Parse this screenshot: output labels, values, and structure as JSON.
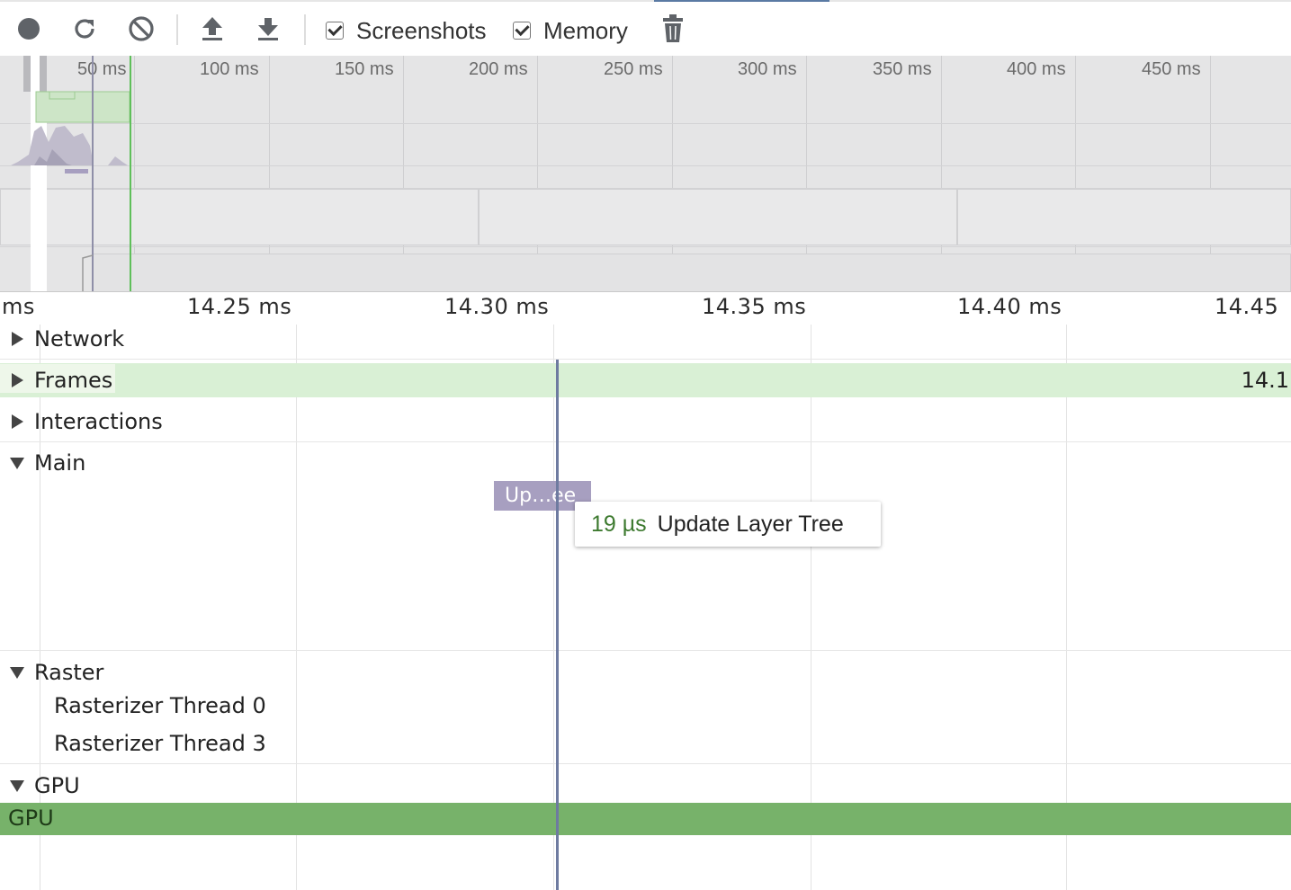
{
  "toolbar": {
    "record_icon": "record-icon",
    "reload_icon": "reload-icon",
    "clear_icon": "clear-icon",
    "upload_icon": "upload-icon",
    "download_icon": "download-icon",
    "screenshots_label": "Screenshots",
    "screenshots_checked": true,
    "memory_label": "Memory",
    "memory_checked": true,
    "trash_icon": "trash-icon"
  },
  "overview": {
    "ticks": [
      "50 ms",
      "100 ms",
      "150 ms",
      "200 ms",
      "250 ms",
      "300 ms",
      "350 ms",
      "400 ms",
      "450 ms"
    ]
  },
  "ruler": {
    "ticks": [
      "ms",
      "14.25 ms",
      "14.30 ms",
      "14.35 ms",
      "14.40 ms",
      "14.45"
    ]
  },
  "tracks": {
    "network": "Network",
    "frames": "Frames",
    "frames_value": "14.1",
    "interactions": "Interactions",
    "main": "Main",
    "raster": "Raster",
    "raster_thread_0": "Rasterizer Thread 0",
    "raster_thread_3": "Rasterizer Thread 3",
    "gpu": "GPU",
    "gpu_bar": "GPU"
  },
  "event": {
    "label": "Up…ee"
  },
  "tooltip": {
    "duration": "19 µs",
    "name": "Update Layer Tree"
  },
  "colors": {
    "frames_bg": "#d9f0d5",
    "gpu_bar": "#77b26a",
    "event": "#a79fc0",
    "cursor": "#6e7ba0",
    "duration_text": "#3d7a2f"
  }
}
